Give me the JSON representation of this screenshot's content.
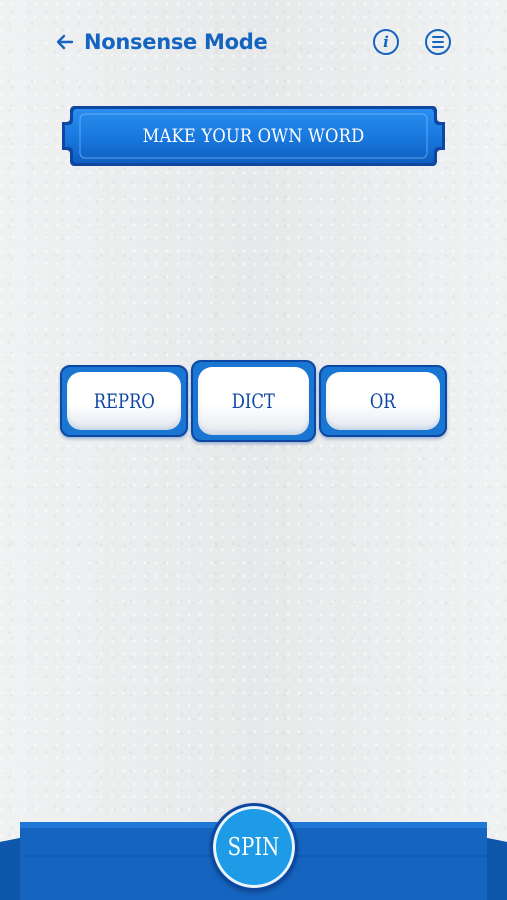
{
  "header": {
    "back_icon": "arrow-left-icon",
    "title": "Nonsense Mode",
    "info_icon": "info-icon",
    "menu_icon": "menu-icon"
  },
  "banner": {
    "label": "MAKE YOUR OWN WORD"
  },
  "reels": [
    {
      "label": "REPRO"
    },
    {
      "label": "DICT"
    },
    {
      "label": "OR"
    }
  ],
  "spin": {
    "label": "SPIN"
  },
  "colors": {
    "primary": "#1565c0",
    "accent": "#1e88e5",
    "spin": "#1e9be6",
    "background": "#ebedee"
  }
}
